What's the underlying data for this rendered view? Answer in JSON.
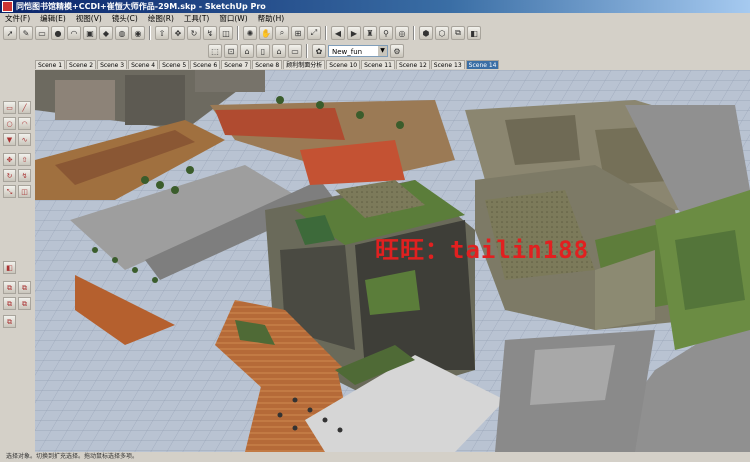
{
  "window": {
    "title": "同恺图书馆精模+CCDI+崔愷大师作品-29M.skp - SketchUp Pro"
  },
  "menu": {
    "items": [
      "文件(F)",
      "编辑(E)",
      "视图(V)",
      "镜头(C)",
      "绘图(R)",
      "工具(T)",
      "窗口(W)",
      "帮助(H)"
    ]
  },
  "toolbar": {
    "style_dropdown": "New_fun"
  },
  "scenes": {
    "tabs": [
      "Scene 1",
      "Scene 2",
      "Scene 3",
      "Scene 4",
      "Scene 5",
      "Scene 6",
      "Scene 7",
      "Scene 8",
      "顾利制面分析",
      "Scene 10",
      "Scene 11",
      "Scene 12",
      "Scene 13",
      "Scene 14"
    ],
    "active_index": 13
  },
  "viewport": {
    "watermark": "旺旺：tailin188"
  },
  "statusbar": {
    "text": "选择对象。切换到扩充选择。拖动鼠标选择多项。"
  },
  "colors": {
    "title_start": "#0a246a",
    "title_end": "#a6caf0",
    "active_tab": "#3a6ea5",
    "sky": "#b9c3d2",
    "watermark": "#e12020"
  }
}
